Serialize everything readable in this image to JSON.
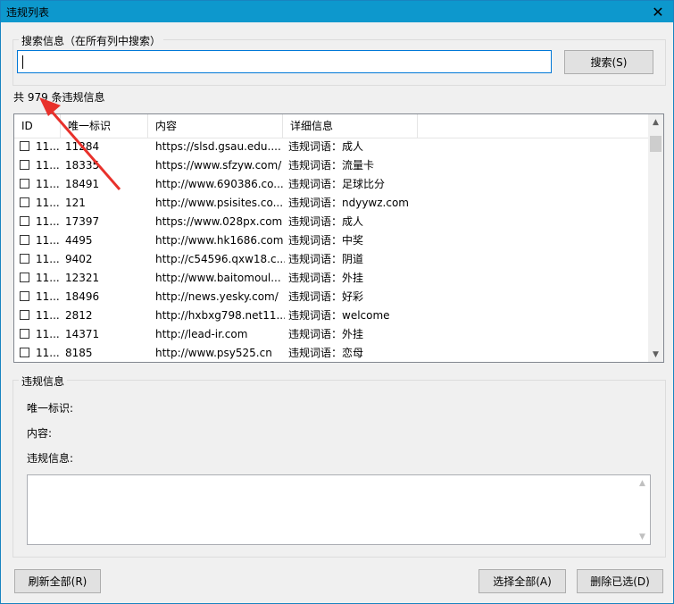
{
  "window": {
    "title": "违规列表",
    "close_label": "✕"
  },
  "search": {
    "group_label": "搜索信息（在所有列中搜索）",
    "value": "",
    "button_label": "搜索(S)"
  },
  "summary": {
    "count_text": "共 979 条违规信息"
  },
  "table": {
    "headers": [
      "ID",
      "唯一标识",
      "内容",
      "详细信息"
    ],
    "rows": [
      {
        "id": "11...",
        "uid": "11284",
        "content": "https://slsd.gsau.edu....",
        "detail": "违规词语：成人"
      },
      {
        "id": "11...",
        "uid": "18335",
        "content": "https://www.sfzyw.com/",
        "detail": "违规词语：流量卡"
      },
      {
        "id": "11...",
        "uid": "18491",
        "content": "http://www.690386.co...",
        "detail": "违规词语：足球比分"
      },
      {
        "id": "11...",
        "uid": "121",
        "content": "http://www.psisites.co...",
        "detail": "违规词语：ndyywz.com"
      },
      {
        "id": "11...",
        "uid": "17397",
        "content": "https://www.028px.com",
        "detail": "违规词语：成人"
      },
      {
        "id": "11...",
        "uid": "4495",
        "content": "http://www.hk1686.com",
        "detail": "违规词语：中奖"
      },
      {
        "id": "11...",
        "uid": "9402",
        "content": "http://c54596.qxw18.c...",
        "detail": "违规词语：阴道"
      },
      {
        "id": "11...",
        "uid": "12321",
        "content": "http://www.baitomoul...",
        "detail": "违规词语：外挂"
      },
      {
        "id": "11...",
        "uid": "18496",
        "content": "http://news.yesky.com/",
        "detail": "违规词语：好彩"
      },
      {
        "id": "11...",
        "uid": "2812",
        "content": "http://hxbxg798.net11...",
        "detail": "违规词语：welcome"
      },
      {
        "id": "11...",
        "uid": "14371",
        "content": "http://lead-ir.com",
        "detail": "违规词语：外挂"
      },
      {
        "id": "11...",
        "uid": "8185",
        "content": "http://www.psy525.cn",
        "detail": "违规词语：恋母"
      }
    ]
  },
  "details": {
    "group_label": "违规信息",
    "uid_label": "唯一标识:",
    "content_label": "内容:",
    "info_label": "违规信息:",
    "info_value": ""
  },
  "buttons": {
    "refresh_all": "刷新全部(R)",
    "select_all": "选择全部(A)",
    "delete_selected": "删除已选(D)"
  },
  "colors": {
    "titlebar": "#0d98cd",
    "annotation_arrow": "#e8312b"
  }
}
